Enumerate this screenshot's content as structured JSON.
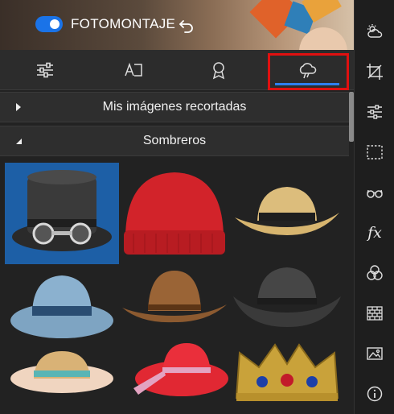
{
  "header": {
    "toggle_label": "FOTOMONTAJE",
    "toggle_on": true
  },
  "tabs": [
    {
      "name": "adjust",
      "icon": "sliders-icon",
      "active": false
    },
    {
      "name": "text",
      "icon": "text-icon",
      "active": false
    },
    {
      "name": "badge",
      "icon": "badge-icon",
      "active": false
    },
    {
      "name": "stickers",
      "icon": "cloud-sticker-icon",
      "active": true
    }
  ],
  "sections": [
    {
      "label": "Mis imágenes recortadas",
      "expanded": false
    },
    {
      "label": "Sombreros",
      "expanded": true
    }
  ],
  "hats": [
    {
      "name": "top-hat-goggles",
      "selected": true
    },
    {
      "name": "red-beanie",
      "selected": false
    },
    {
      "name": "straw-cowboy-hat",
      "selected": false
    },
    {
      "name": "blue-fedora",
      "selected": false
    },
    {
      "name": "brown-cowboy-hat",
      "selected": false
    },
    {
      "name": "gray-cowboy-hat",
      "selected": false
    },
    {
      "name": "straw-sun-hat",
      "selected": false
    },
    {
      "name": "red-sun-hat",
      "selected": false
    },
    {
      "name": "gold-crown",
      "selected": false
    }
  ],
  "sidebar": [
    "weather-icon",
    "crop-icon",
    "sliders-icon",
    "selection-icon",
    "glasses-icon",
    "fx-icon",
    "overlay-icon",
    "bricks-icon",
    "image-icon",
    "info-icon"
  ],
  "sidebar_fx_label": "fx",
  "colors": {
    "accent": "#2d7ff0",
    "toggle": "#1a73e8",
    "highlight": "#e01010",
    "selected_cell": "#1d5fa6"
  }
}
